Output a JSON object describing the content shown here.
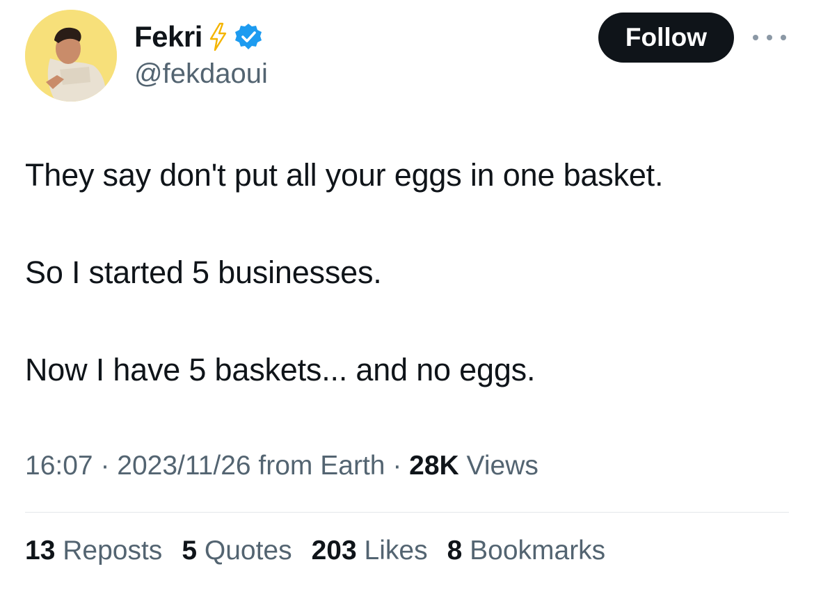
{
  "author": {
    "display_name": "Fekri",
    "handle": "@fekdaoui"
  },
  "icons": {
    "bolt": "lightning-bolt-icon",
    "verified": "verified-badge-icon",
    "more": "more-options-icon"
  },
  "actions": {
    "follow_label": "Follow"
  },
  "tweet": {
    "lines": [
      "They say don't put all your eggs in one basket.",
      "So I started 5 businesses.",
      "Now I have 5 baskets... and no eggs."
    ]
  },
  "meta": {
    "time": "16:07",
    "date": "2023/11/26",
    "source": "from Earth",
    "views_count": "28K",
    "views_label": "Views"
  },
  "stats": [
    {
      "count": "13",
      "label": "Reposts"
    },
    {
      "count": "5",
      "label": "Quotes"
    },
    {
      "count": "203",
      "label": "Likes"
    },
    {
      "count": "8",
      "label": "Bookmarks"
    }
  ],
  "colors": {
    "text": "#0f1419",
    "secondary": "#536471",
    "verified_blue": "#1d9bf0",
    "bolt": "#f4b400",
    "avatar_bg": "#f7e07a",
    "divider": "#e3e7ea"
  }
}
